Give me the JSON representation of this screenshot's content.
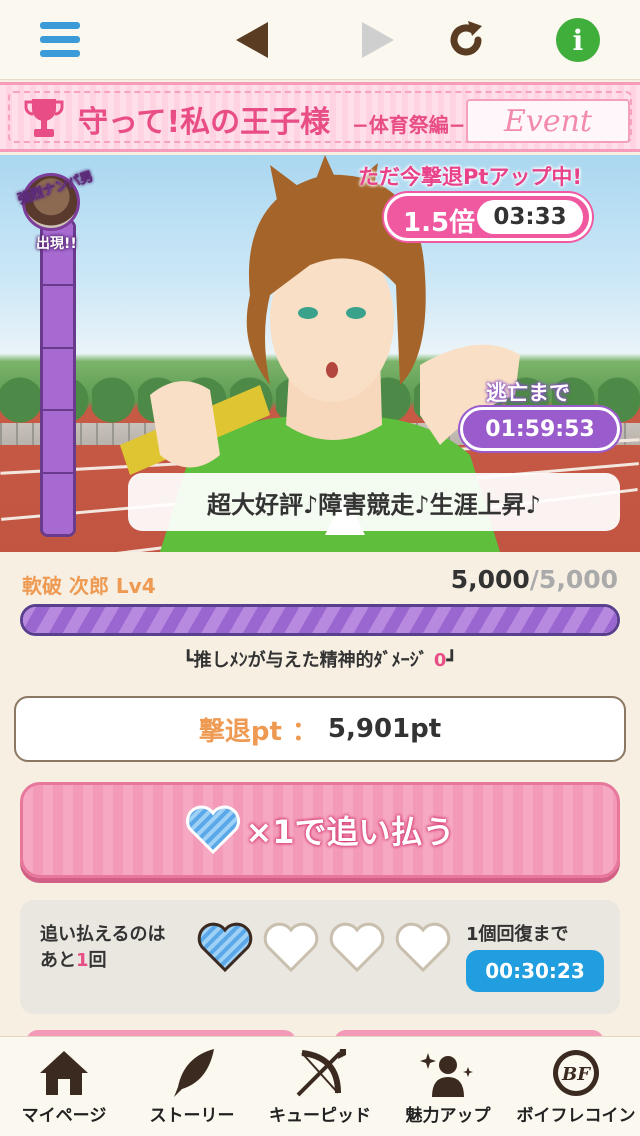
{
  "topbar": {
    "menu_icon": "hamburger-icon",
    "back_icon": "triangle-left-icon",
    "forward_icon": "triangle-right-icon",
    "reload_icon": "reload-icon",
    "info_icon": "info-icon",
    "info_symbol": "i",
    "accent": "#3b9ad8"
  },
  "event": {
    "title": "守って!私の王子様",
    "subtitle": "−体育祭編−",
    "tag": "Event",
    "icon": "trophy-icon",
    "color": "#e84e85"
  },
  "scene": {
    "enemy_name": "強烈ナンパ男",
    "enemy_appear": "出現!!",
    "gauge_level": 1.0,
    "gauge_segments": 5,
    "boost_caption": "ただ今撃退Ptアップ中!",
    "boost_rate": "1.5倍",
    "boost_timer": "03:33",
    "escape_label": "逃亡まで",
    "escape_timer": "01:59:53",
    "speech": "超大好評♪障害競走♪生涯上昇♪"
  },
  "enemy_status": {
    "name": "軟破 次郎 Lv4",
    "hp_current": "5,000",
    "hp_sep": "/",
    "hp_max": "5,000",
    "hp_fraction": 1.0,
    "damage_prefix": "┗推しﾒﾝが与えた精神的ﾀﾞﾒｰｼﾞ",
    "damage_value": "0",
    "damage_suffix": "┛"
  },
  "points": {
    "label": "撃退pt",
    "colon": "：",
    "value": "5,901pt"
  },
  "chase_button": {
    "label": "×1で追い払う",
    "icon": "blue-heart-icon"
  },
  "stamina": {
    "line1": "追い払えるのは",
    "line2_prefix": "あと",
    "line2_count": "1",
    "line2_suffix": "回",
    "hearts_filled": 1,
    "hearts_total": 4,
    "recover_label": "1個回復まで",
    "recover_timer": "00:30:23"
  },
  "nav": {
    "items": [
      {
        "label": "マイページ",
        "icon": "house-icon"
      },
      {
        "label": "ストーリー",
        "icon": "quill-icon"
      },
      {
        "label": "キューピッド",
        "icon": "bow-arrow-icon"
      },
      {
        "label": "魅力アップ",
        "icon": "sparkle-person-icon"
      },
      {
        "label": "ボイフレコイン",
        "icon": "bf-coin-icon"
      }
    ]
  }
}
